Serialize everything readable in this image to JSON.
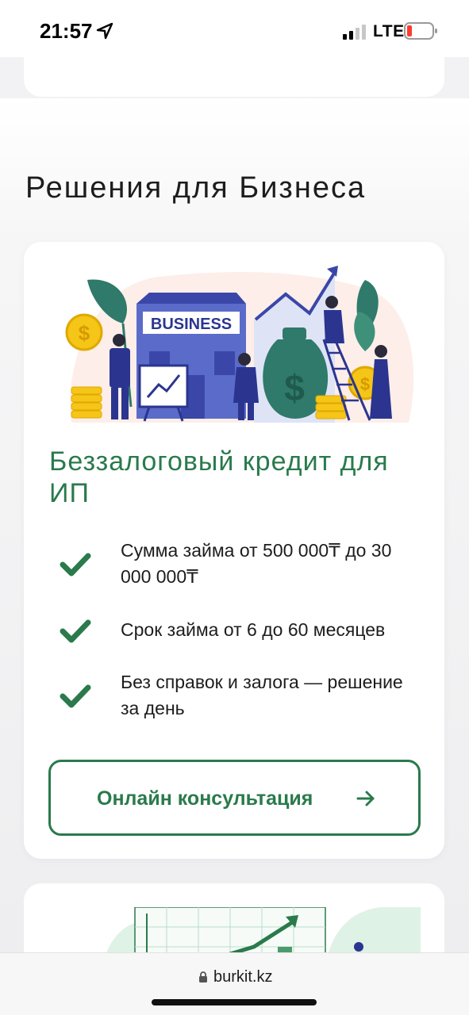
{
  "status_bar": {
    "time": "21:57",
    "network": "LTE",
    "battery_color": "#ff3b30"
  },
  "section": {
    "title": "Решения для Бизнеса"
  },
  "card": {
    "illustration_sign": "BUSINESS",
    "title": "Беззалоговый кредит для ИП",
    "features": [
      {
        "text": "Сумма займа от 500 000₸ до 30 000 000₸"
      },
      {
        "text": "Срок займа от 6 до 60 месяцев"
      },
      {
        "text": "Без справок и залога — решение за день"
      }
    ],
    "button_label": "Онлайн консультация"
  },
  "browser": {
    "url": "burkit.kz"
  },
  "colors": {
    "accent": "#2a7a4c",
    "illustration_blue": "#5b6bc9",
    "illustration_teal": "#2f7a6a",
    "coin": "#f5c518"
  }
}
